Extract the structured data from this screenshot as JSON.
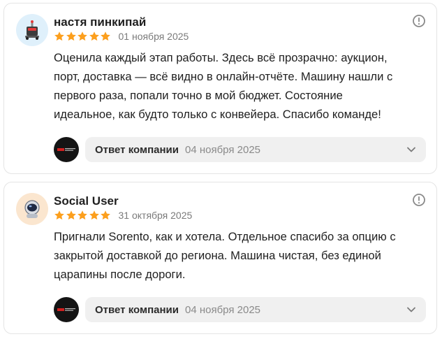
{
  "reviews": [
    {
      "author": "настя пинкипай",
      "rating": 5,
      "date": "01 ноября 2025",
      "text": "Оценила каждый этап работы. Здесь всё прозрачно: аукцион,\nпорт, доставка — всё видно в онлайн-отчёте. Машину нашли с\nпервого раза, попали точно в мой бюджет. Состояние\nидеальное, как будто только с конвейера. Спасибо команде!",
      "avatar_icon": "robot-avatar-icon",
      "answer": {
        "label": "Ответ компании",
        "date": "04 ноября 2025"
      }
    },
    {
      "author": "Social User",
      "rating": 5,
      "date": "31 октября 2025",
      "text": "Пригнали Sorento, как и хотела. Отдельное спасибо за опцию с\nзакрытой доставкой до региона. Машина чистая, без единой\nцарапины после дороги.",
      "avatar_icon": "astronaut-avatar-icon",
      "answer": {
        "label": "Ответ компании",
        "date": "04 ноября 2025"
      }
    }
  ],
  "colors": {
    "star": "#fc9f1d",
    "answer_bg": "#f0f0f0",
    "muted_text": "#7a7a7a"
  }
}
